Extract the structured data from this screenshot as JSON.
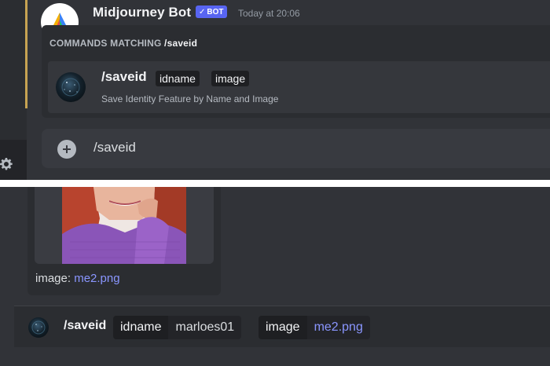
{
  "message": {
    "bot_name": "Midjourney Bot",
    "bot_badge": "BOT",
    "badge_check": "✓",
    "timestamp": "Today at 20:06"
  },
  "autocomplete": {
    "header_prefix": "COMMANDS MATCHING ",
    "header_query": "/saveid",
    "command": {
      "name": "/saveid",
      "options": [
        "idname",
        "image"
      ],
      "description": "Save Identity Feature by Name and Image"
    }
  },
  "input": {
    "value": "/saveid"
  },
  "attachment": {
    "caption_label": "image: ",
    "caption_file": "me2.png"
  },
  "slash_preview": {
    "command": "/saveid",
    "params": [
      {
        "key": "idname",
        "value": "marloes01"
      },
      {
        "key": "image",
        "value": "me2.png"
      }
    ]
  },
  "icons": {
    "gear": "gear-icon",
    "plus": "plus-circle-icon",
    "bot_avatar": "sailboat-logo-icon",
    "app_avatar": "starfield-avatar-icon"
  },
  "colors": {
    "background": "#313338",
    "accent": "#5865f2",
    "link": "#8a96ff",
    "mention_bar": "#c7a352"
  }
}
